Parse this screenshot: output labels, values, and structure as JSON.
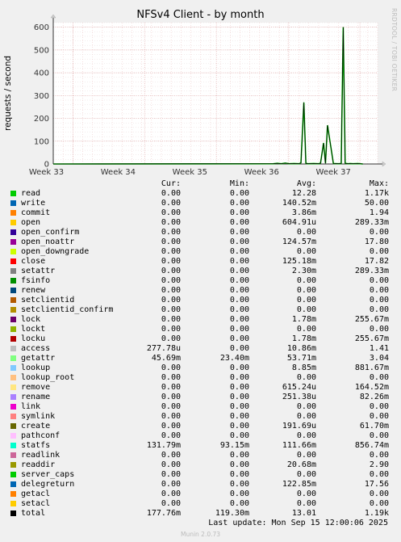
{
  "title": "NFSv4 Client - by month",
  "side_label": "RRDTOOL / TOBI OETIKER",
  "footer": "Last update: Mon Sep 15 12:00:06 2025",
  "version": "Munin 2.0.73",
  "legend_headers": {
    "cur": "Cur:",
    "min": "Min:",
    "avg": "Avg:",
    "max": "Max:"
  },
  "legend": [
    {
      "name": "read",
      "color": "#00cc00",
      "cur": "0.00",
      "min": "0.00",
      "avg": "12.28",
      "max": "1.17k"
    },
    {
      "name": "write",
      "color": "#0066b3",
      "cur": "0.00",
      "min": "0.00",
      "avg": "140.52m",
      "max": "50.00"
    },
    {
      "name": "commit",
      "color": "#ff8000",
      "cur": "0.00",
      "min": "0.00",
      "avg": "3.86m",
      "max": "1.94"
    },
    {
      "name": "open",
      "color": "#ffcc00",
      "cur": "0.00",
      "min": "0.00",
      "avg": "604.91u",
      "max": "289.33m"
    },
    {
      "name": "open_confirm",
      "color": "#330099",
      "cur": "0.00",
      "min": "0.00",
      "avg": "0.00",
      "max": "0.00"
    },
    {
      "name": "open_noattr",
      "color": "#990099",
      "cur": "0.00",
      "min": "0.00",
      "avg": "124.57m",
      "max": "17.80"
    },
    {
      "name": "open_downgrade",
      "color": "#ccff00",
      "cur": "0.00",
      "min": "0.00",
      "avg": "0.00",
      "max": "0.00"
    },
    {
      "name": "close",
      "color": "#ff0000",
      "cur": "0.00",
      "min": "0.00",
      "avg": "125.18m",
      "max": "17.82"
    },
    {
      "name": "setattr",
      "color": "#808080",
      "cur": "0.00",
      "min": "0.00",
      "avg": "2.30m",
      "max": "289.33m"
    },
    {
      "name": "fsinfo",
      "color": "#008f00",
      "cur": "0.00",
      "min": "0.00",
      "avg": "0.00",
      "max": "0.00"
    },
    {
      "name": "renew",
      "color": "#00487d",
      "cur": "0.00",
      "min": "0.00",
      "avg": "0.00",
      "max": "0.00"
    },
    {
      "name": "setclientid",
      "color": "#b35a00",
      "cur": "0.00",
      "min": "0.00",
      "avg": "0.00",
      "max": "0.00"
    },
    {
      "name": "setclientid_confirm",
      "color": "#b38f00",
      "cur": "0.00",
      "min": "0.00",
      "avg": "0.00",
      "max": "0.00"
    },
    {
      "name": "lock",
      "color": "#6b006b",
      "cur": "0.00",
      "min": "0.00",
      "avg": "1.78m",
      "max": "255.67m"
    },
    {
      "name": "lockt",
      "color": "#8fb300",
      "cur": "0.00",
      "min": "0.00",
      "avg": "0.00",
      "max": "0.00"
    },
    {
      "name": "locku",
      "color": "#b30000",
      "cur": "0.00",
      "min": "0.00",
      "avg": "1.78m",
      "max": "255.67m"
    },
    {
      "name": "access",
      "color": "#bebebe",
      "cur": "277.78u",
      "min": "0.00",
      "avg": "10.86m",
      "max": "1.41"
    },
    {
      "name": "getattr",
      "color": "#80ff80",
      "cur": "45.69m",
      "min": "23.40m",
      "avg": "53.71m",
      "max": "3.04"
    },
    {
      "name": "lookup",
      "color": "#80c9ff",
      "cur": "0.00",
      "min": "0.00",
      "avg": "8.85m",
      "max": "881.67m"
    },
    {
      "name": "lookup_root",
      "color": "#ffc080",
      "cur": "0.00",
      "min": "0.00",
      "avg": "0.00",
      "max": "0.00"
    },
    {
      "name": "remove",
      "color": "#ffe680",
      "cur": "0.00",
      "min": "0.00",
      "avg": "615.24u",
      "max": "164.52m"
    },
    {
      "name": "rename",
      "color": "#aa80ff",
      "cur": "0.00",
      "min": "0.00",
      "avg": "251.38u",
      "max": "82.26m"
    },
    {
      "name": "link",
      "color": "#ee00cc",
      "cur": "0.00",
      "min": "0.00",
      "avg": "0.00",
      "max": "0.00"
    },
    {
      "name": "symlink",
      "color": "#ff8080",
      "cur": "0.00",
      "min": "0.00",
      "avg": "0.00",
      "max": "0.00"
    },
    {
      "name": "create",
      "color": "#666600",
      "cur": "0.00",
      "min": "0.00",
      "avg": "191.69u",
      "max": "61.70m"
    },
    {
      "name": "pathconf",
      "color": "#ffbfff",
      "cur": "0.00",
      "min": "0.00",
      "avg": "0.00",
      "max": "0.00"
    },
    {
      "name": "statfs",
      "color": "#00ffcc",
      "cur": "131.79m",
      "min": "93.15m",
      "avg": "111.66m",
      "max": "856.74m"
    },
    {
      "name": "readlink",
      "color": "#cc6699",
      "cur": "0.00",
      "min": "0.00",
      "avg": "0.00",
      "max": "0.00"
    },
    {
      "name": "readdir",
      "color": "#999900",
      "cur": "0.00",
      "min": "0.00",
      "avg": "20.68m",
      "max": "2.90"
    },
    {
      "name": "server_caps",
      "color": "#00cc00",
      "cur": "0.00",
      "min": "0.00",
      "avg": "0.00",
      "max": "0.00"
    },
    {
      "name": "delegreturn",
      "color": "#0066b3",
      "cur": "0.00",
      "min": "0.00",
      "avg": "122.85m",
      "max": "17.56"
    },
    {
      "name": "getacl",
      "color": "#ff8000",
      "cur": "0.00",
      "min": "0.00",
      "avg": "0.00",
      "max": "0.00"
    },
    {
      "name": "setacl",
      "color": "#ffcc00",
      "cur": "0.00",
      "min": "0.00",
      "avg": "0.00",
      "max": "0.00"
    },
    {
      "name": "total",
      "color": "#000000",
      "cur": "177.76m",
      "min": "119.30m",
      "avg": "13.01",
      "max": "1.19k"
    }
  ],
  "chart_data": {
    "type": "line",
    "title": "NFSv4 Client - by month",
    "ylabel": "requests / second",
    "xlabel": "",
    "ylim": [
      0,
      620
    ],
    "y_ticks": [
      0,
      100,
      200,
      300,
      400,
      500,
      600
    ],
    "x_ticks": [
      "Week 33",
      "Week 34",
      "Week 35",
      "Week 36",
      "Week 37"
    ],
    "grid": true,
    "series": [
      {
        "name": "total",
        "x_days": [
          0,
          22.4,
          22.8,
          23.2,
          23.6,
          24.0,
          24.5,
          25.0,
          25.2,
          25.5,
          25.7,
          25.9,
          26.5,
          27.0,
          27.2,
          27.5,
          27.7,
          27.9,
          28.5,
          29.0,
          29.3,
          29.5,
          29.7,
          30.0,
          30.2,
          30.5,
          31.0,
          31.5
        ],
        "values": [
          0,
          1,
          3,
          1,
          4,
          1,
          2,
          1,
          5,
          270,
          3,
          1,
          2,
          1,
          4,
          92,
          3,
          170,
          2,
          1,
          2,
          600,
          3,
          1,
          2,
          1,
          2,
          0
        ]
      }
    ]
  }
}
